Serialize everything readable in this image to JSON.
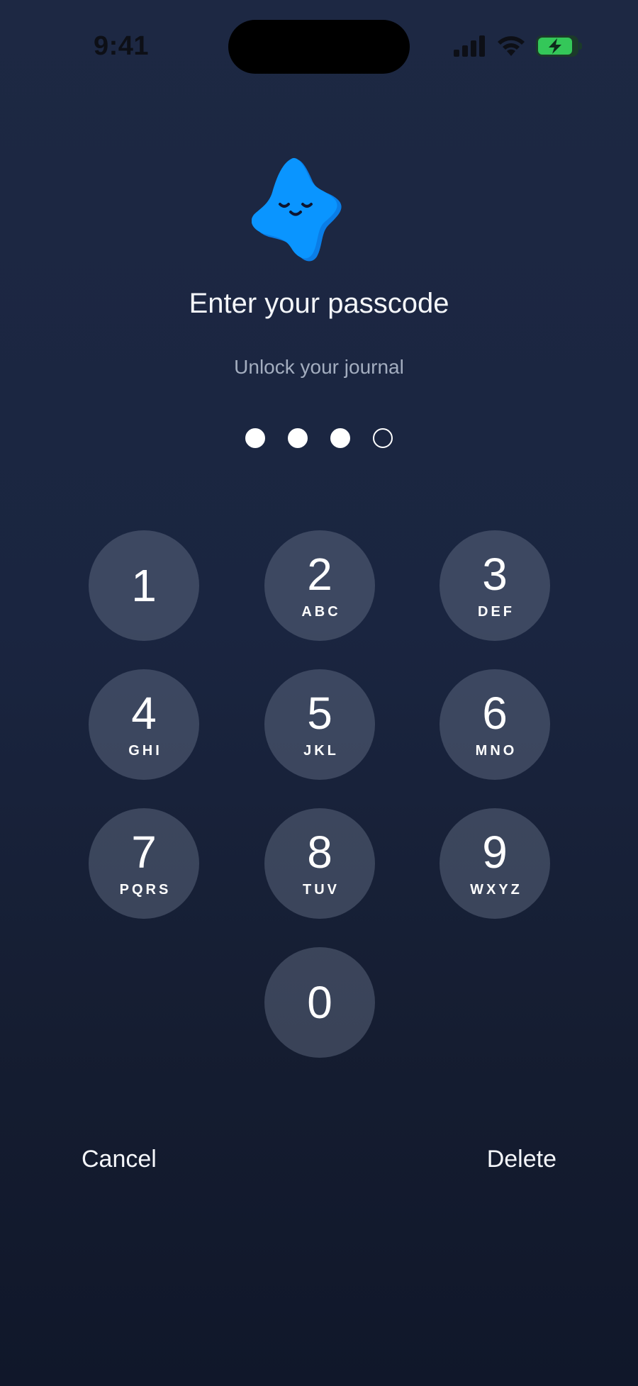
{
  "status_bar": {
    "time": "9:41",
    "battery_color": "#34c759"
  },
  "header": {
    "mascot_icon": "smiling-star-mascot",
    "title": "Enter your passcode",
    "subtitle": "Unlock your journal",
    "accent_color": "#0a95ff"
  },
  "passcode": {
    "length": 4,
    "filled": 3
  },
  "keypad": {
    "keys": [
      {
        "digit": "1",
        "letters": ""
      },
      {
        "digit": "2",
        "letters": "ABC"
      },
      {
        "digit": "3",
        "letters": "DEF"
      },
      {
        "digit": "4",
        "letters": "GHI"
      },
      {
        "digit": "5",
        "letters": "JKL"
      },
      {
        "digit": "6",
        "letters": "MNO"
      },
      {
        "digit": "7",
        "letters": "PQRS"
      },
      {
        "digit": "8",
        "letters": "TUV"
      },
      {
        "digit": "9",
        "letters": "WXYZ"
      },
      {
        "digit": "0",
        "letters": ""
      }
    ]
  },
  "actions": {
    "cancel_label": "Cancel",
    "delete_label": "Delete"
  }
}
